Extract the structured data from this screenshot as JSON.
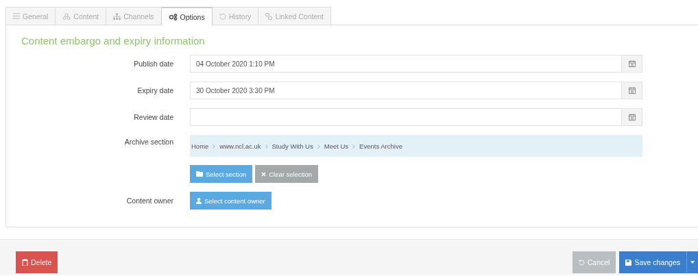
{
  "tabs": [
    {
      "label": "General",
      "selected": false
    },
    {
      "label": "Content",
      "selected": false
    },
    {
      "label": "Channels",
      "selected": false
    },
    {
      "label": "Options",
      "selected": true
    },
    {
      "label": "History",
      "selected": false
    },
    {
      "label": "Linked Content",
      "selected": false
    }
  ],
  "section_title": "Content embargo and expiry information",
  "date_fields": [
    {
      "label": "Publish date",
      "value": "04 October 2020 1:10 PM"
    },
    {
      "label": "Expiry date",
      "value": "30 October 2020 3:30 PM"
    },
    {
      "label": "Review date"
    }
  ],
  "archive_section": {
    "label": "Archive section",
    "breadcrumb": [
      "Home",
      "www.ncl.ac.uk",
      "Study With Us",
      "Meet Us",
      "Events Archive"
    ],
    "buttons": [
      {
        "label": "Select section",
        "kind": "primary"
      },
      {
        "label": "Clear selection",
        "kind": "default"
      }
    ]
  },
  "content_owner": {
    "label": "Content owner",
    "button": {
      "label": "Select content owner",
      "kind": "primary"
    }
  },
  "footer": {
    "left": [
      {
        "label": "Delete",
        "kind": "danger"
      }
    ],
    "right": [
      {
        "label": "Cancel",
        "kind": "muted"
      },
      {
        "label": "Save changes",
        "kind": "save"
      }
    ]
  }
}
